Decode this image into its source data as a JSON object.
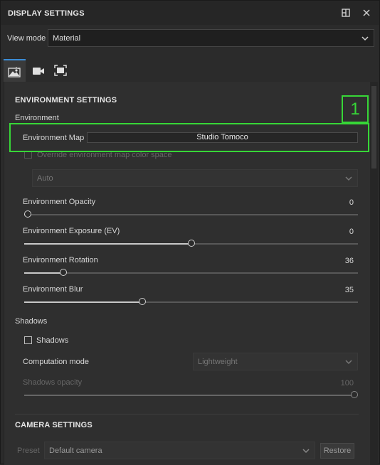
{
  "title": "DISPLAY SETTINGS",
  "view_mode": {
    "label": "View mode",
    "value": "Material"
  },
  "tabs": [
    {
      "icon": "environment-icon",
      "active": true
    },
    {
      "icon": "camera-icon",
      "active": false
    },
    {
      "icon": "frame-icon",
      "active": false
    }
  ],
  "environment_settings": {
    "title": "ENVIRONMENT SETTINGS",
    "group_label": "Environment",
    "env_map_label": "Environment Map",
    "env_map_value": "Studio Tomoco",
    "override_label": "Override environment map color space",
    "color_space_value": "Auto",
    "sliders": [
      {
        "label": "Environment Opacity",
        "value": "0",
        "level": 0.0
      },
      {
        "label": "Environment Exposure (EV)",
        "value": "0",
        "level": 0.5
      },
      {
        "label": "Environment Rotation",
        "value": "36",
        "level": 0.11
      },
      {
        "label": "Environment Blur",
        "value": "35",
        "level": 0.35
      }
    ]
  },
  "shadows": {
    "group_label": "Shadows",
    "checkbox_label": "Shadows",
    "computation_label": "Computation mode",
    "computation_value": "Lightweight",
    "opacity_label": "Shadows opacity",
    "opacity_value": "100",
    "opacity_level": 1.0
  },
  "camera_settings": {
    "title": "CAMERA SETTINGS",
    "preset_label": "Preset",
    "preset_value": "Default camera",
    "restore_label": "Restore"
  },
  "annotation": {
    "tag": "1",
    "color": "#37d737"
  },
  "colors": {
    "accent": "#3b8dd6",
    "highlight": "#37d737"
  }
}
